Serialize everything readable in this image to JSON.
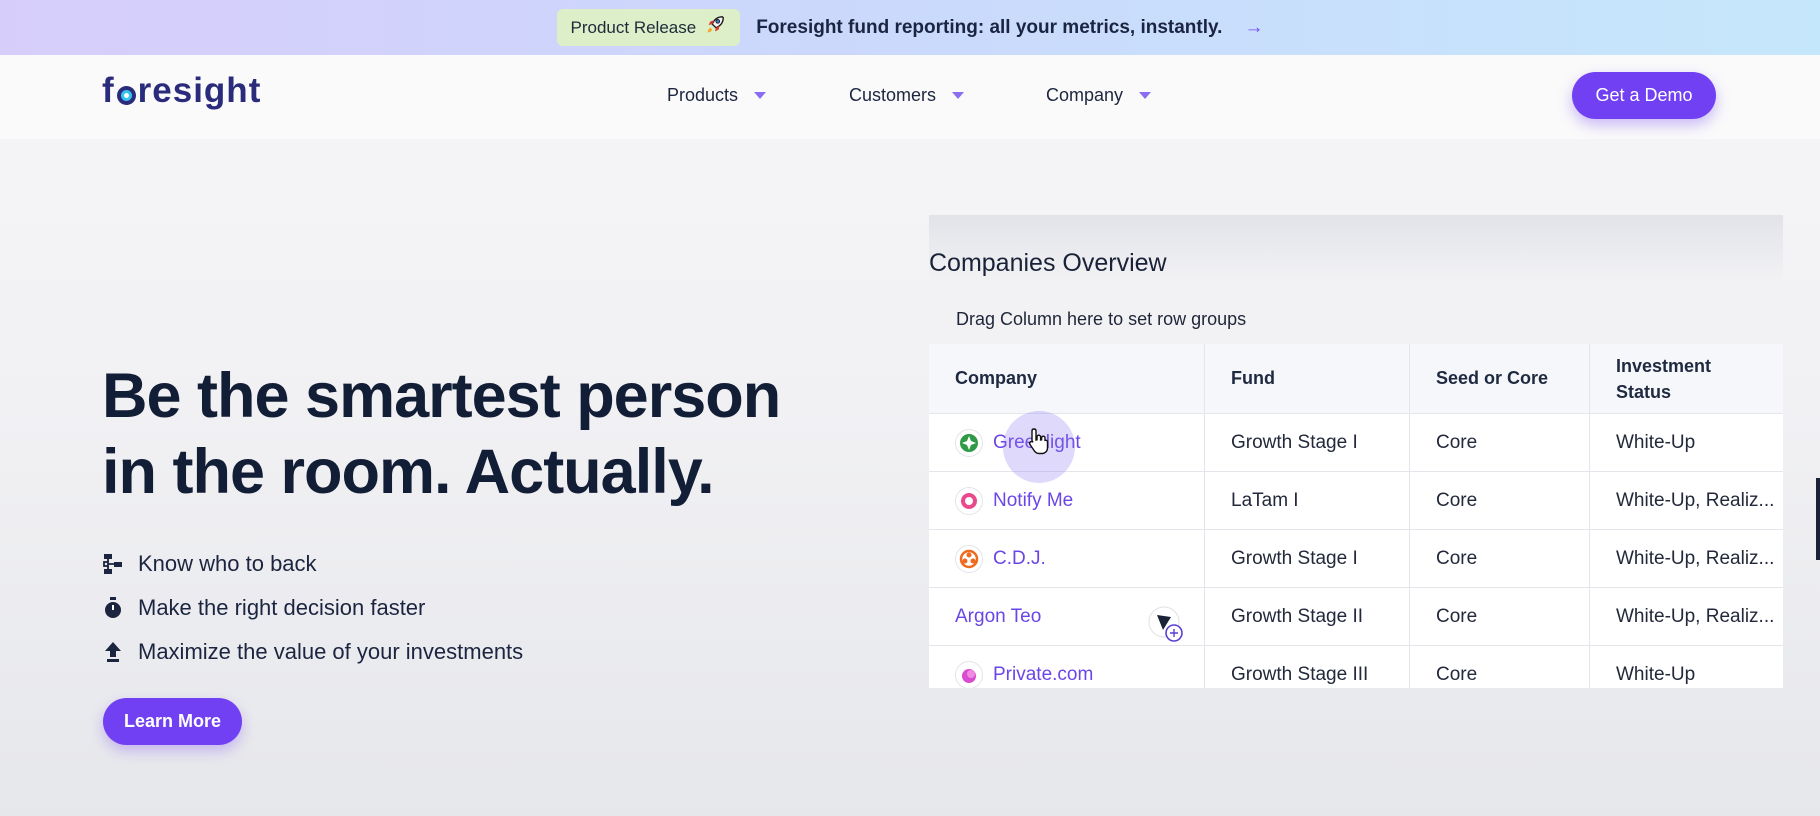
{
  "banner": {
    "badge_label": "Product Release",
    "badge_icon": "rocket-icon",
    "text": "Foresight fund reporting: all your metrics, instantly.",
    "arrow": "→"
  },
  "header": {
    "logo": {
      "pre": "f",
      "post": "resight"
    },
    "nav": [
      {
        "label": "Products"
      },
      {
        "label": "Customers"
      },
      {
        "label": "Company"
      }
    ],
    "demo_label": "Get a Demo"
  },
  "hero": {
    "title_line1": "Be the smartest person",
    "title_line2": "in the room. Actually.",
    "features": [
      {
        "icon": "flow-icon",
        "text": "Know who to back"
      },
      {
        "icon": "stopwatch-icon",
        "text": "Make the right decision faster"
      },
      {
        "icon": "upload-arrow-icon",
        "text": "Maximize the value of your investments"
      }
    ],
    "learn_more_label": "Learn More"
  },
  "overview": {
    "title": "Companies Overview",
    "group_hint": "Drag Column here to set row groups",
    "columns": [
      "Company",
      "Fund",
      "Seed or Core",
      "Investment Status"
    ],
    "rows": [
      {
        "company": "Greenlight",
        "fund": "Growth Stage I",
        "type": "Core",
        "status": "White-Up"
      },
      {
        "company": "Notify Me",
        "fund": "LaTam I",
        "type": "Core",
        "status": "White-Up, Realiz..."
      },
      {
        "company": "C.D.J.",
        "fund": "Growth Stage I",
        "type": "Core",
        "status": "White-Up, Realiz..."
      },
      {
        "company": "Argon Teo",
        "fund": "Growth Stage II",
        "type": "Core",
        "status": "White-Up, Realiz..."
      },
      {
        "company": "Private.com",
        "fund": "Growth Stage III",
        "type": "Core",
        "status": "White-Up"
      }
    ]
  },
  "colors": {
    "accent": "#7040f2",
    "link": "#6a46e6",
    "heading": "#121d36"
  }
}
